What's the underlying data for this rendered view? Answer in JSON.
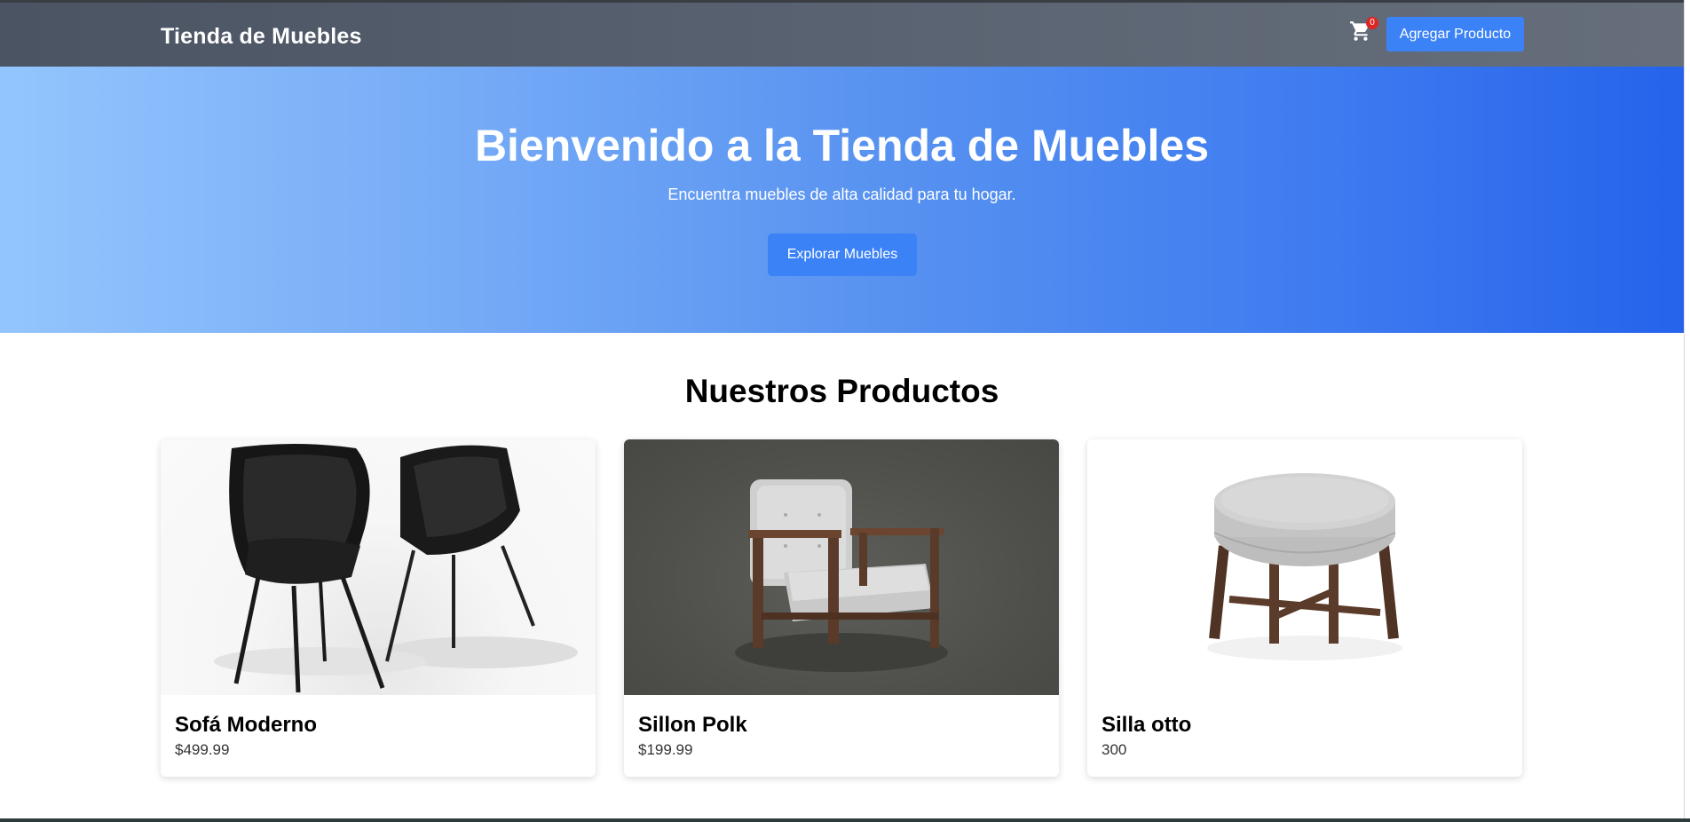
{
  "navbar": {
    "brand": "Tienda de Muebles",
    "cart_icon": "shopping-cart-icon",
    "cart_count": "0",
    "add_product_label": "Agregar Producto"
  },
  "hero": {
    "title": "Bienvenido a la Tienda de Muebles",
    "subtitle": "Encuentra muebles de alta calidad para tu hogar.",
    "button_label": "Explorar Muebles"
  },
  "products": {
    "title": "Nuestros Productos",
    "items": [
      {
        "name": "Sofá Moderno",
        "price": "$499.99",
        "image": "black-leather-chairs"
      },
      {
        "name": "Sillon Polk",
        "price": "$199.99",
        "image": "grey-armchair-wood-frame"
      },
      {
        "name": "Silla otto",
        "price": "300",
        "image": "round-grey-ottoman"
      }
    ]
  },
  "colors": {
    "navbar": "#555e6c",
    "accent": "#3b82f6",
    "hero_start": "#93c5fd",
    "hero_end": "#2563eb",
    "badge": "#e02424"
  }
}
